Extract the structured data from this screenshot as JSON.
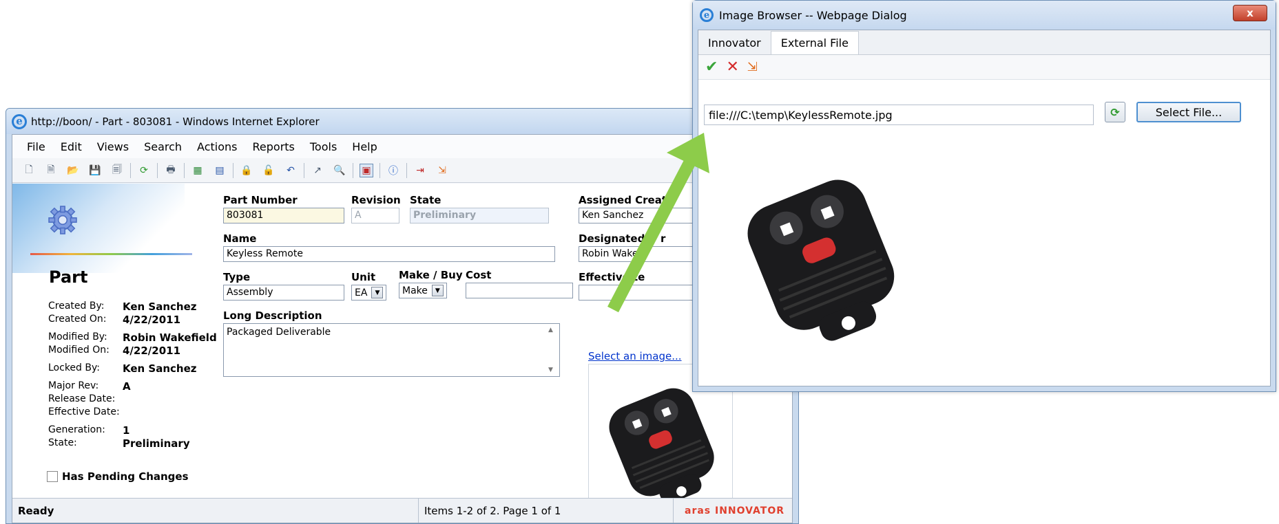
{
  "ie": {
    "title": "http://boon/ - Part - 803081 - Windows Internet Explorer",
    "menu": [
      "File",
      "Edit",
      "Views",
      "Search",
      "Actions",
      "Reports",
      "Tools",
      "Help"
    ]
  },
  "sidebar": {
    "title": "Part",
    "props": [
      {
        "key": "Created By:",
        "value": "Ken Sanchez"
      },
      {
        "key": "Created On:",
        "value": "4/22/2011"
      },
      {
        "key": "Modified By:",
        "value": "Robin Wakefield"
      },
      {
        "key": "Modified On:",
        "value": "4/22/2011"
      },
      {
        "key": "Locked By:",
        "value": "Ken Sanchez"
      },
      {
        "key": "Major Rev:",
        "value": "A"
      },
      {
        "key": "Release Date:",
        "value": ""
      },
      {
        "key": "Effective Date:",
        "value": ""
      },
      {
        "key": "Generation:",
        "value": "1"
      },
      {
        "key": "State:",
        "value": "Preliminary"
      }
    ],
    "pending_label": "Has Pending Changes"
  },
  "form": {
    "part_number_label": "Part Number",
    "part_number": "803081",
    "revision_label": "Revision",
    "revision": "A",
    "state_label": "State",
    "state": "Preliminary",
    "name_label": "Name",
    "name": "Keyless Remote",
    "type_label": "Type",
    "type": "Assembly",
    "unit_label": "Unit",
    "unit": "EA",
    "makebuy_label": "Make / Buy",
    "makebuy": "Make",
    "cost_label": "Cost",
    "cost": "",
    "long_desc_label": "Long Description",
    "long_desc": "Packaged Deliverable",
    "assigned_label": "Assigned Creat",
    "assigned": "Ken Sanchez",
    "designated_label": "Designated U   r",
    "designated": "Robin Wake     d",
    "effective_label": "Effective    te",
    "effective": "",
    "select_image": "Select an image..."
  },
  "status": {
    "ready": "Ready",
    "items": "Items 1-2 of 2. Page 1 of 1",
    "brand": "aras INNOVATOR"
  },
  "dialog": {
    "title": "Image Browser -- Webpage Dialog",
    "close": "x",
    "tabs": [
      "Innovator",
      "External File"
    ],
    "path": "file:///C:\\temp\\KeylessRemote.jpg",
    "select_file": "Select File..."
  },
  "colors": {
    "arrow": "#8dcc4a",
    "brand_red": "#e0402e",
    "link_blue": "#0033cc"
  }
}
